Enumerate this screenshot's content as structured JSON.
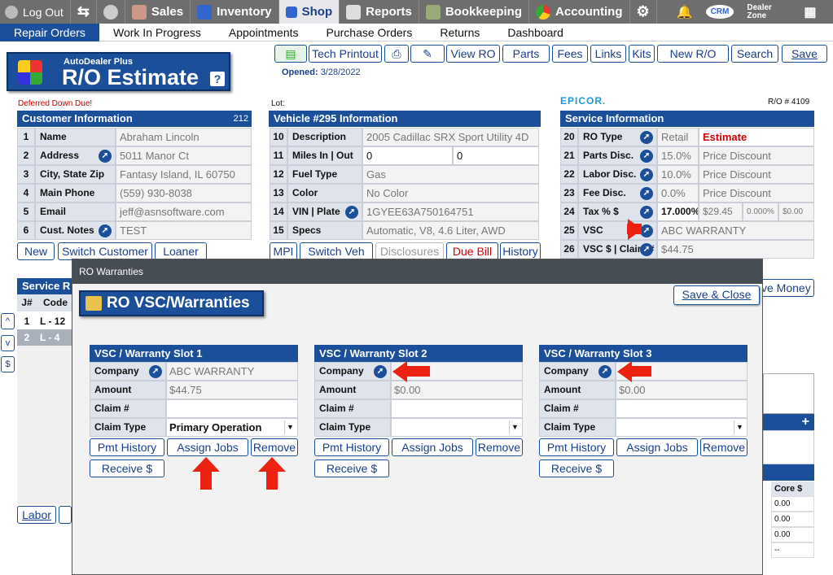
{
  "topnav": {
    "logout": "Log Out",
    "sales": "Sales",
    "inventory": "Inventory",
    "shop": "Shop",
    "reports": "Reports",
    "bookkeeping": "Bookkeeping",
    "accounting": "Accounting",
    "crm": "CRM",
    "dealer_zone": "Dealer Zone"
  },
  "subnav": [
    "Repair Orders",
    "Work In Progress",
    "Appointments",
    "Purchase Orders",
    "Returns",
    "Dashboard"
  ],
  "brand": {
    "small": "AutoDealer Plus",
    "title": "R/O Estimate",
    "help": "?"
  },
  "toolbar": {
    "tech_printout": "Tech Printout",
    "view_ro": "View RO",
    "parts": "Parts",
    "fees": "Fees",
    "links": "Links",
    "kits": "Kits",
    "new_ro": "New R/O",
    "search": "Search",
    "save": "Save"
  },
  "opened_label": "Opened:",
  "opened_date": "3/28/2022",
  "deferred": "Deferred Down Due!",
  "lot_label": "Lot:",
  "epicor": "EPICOR.",
  "ro_number": "R/O # 4109",
  "customer": {
    "title": "Customer Information",
    "code": "212",
    "rows": [
      {
        "n": "1",
        "label": "Name",
        "value": "Abraham Lincoln"
      },
      {
        "n": "2",
        "label": "Address",
        "value": "5011 Manor Ct"
      },
      {
        "n": "3",
        "label": "City, State Zip",
        "value": "Fantasy Island, IL 60750"
      },
      {
        "n": "4",
        "label": "Main Phone",
        "value": "(559) 930-8038"
      },
      {
        "n": "5",
        "label": "Email",
        "value": "jeff@asnsoftware.com"
      },
      {
        "n": "6",
        "label": "Cust. Notes",
        "value": "TEST"
      }
    ],
    "buttons": {
      "new": "New",
      "switch": "Switch Customer",
      "loaner": "Loaner"
    }
  },
  "vehicle": {
    "title": "Vehicle #295 Information",
    "rows": [
      {
        "n": "10",
        "label": "Description",
        "value": "2005 Cadillac SRX Sport Utility 4D"
      },
      {
        "n": "11",
        "label": "Miles  In | Out",
        "value": "0",
        "value2": "0"
      },
      {
        "n": "12",
        "label": "Fuel Type",
        "value": "Gas"
      },
      {
        "n": "13",
        "label": "Color",
        "value": "No Color"
      },
      {
        "n": "14",
        "label": "VIN | Plate",
        "value": "1GYEE63A750164751"
      },
      {
        "n": "15",
        "label": "Specs",
        "value": "Automatic, V8, 4.6 Liter, AWD"
      }
    ],
    "buttons": {
      "mpi": "MPI",
      "switch": "Switch Veh",
      "disclosures": "Disclosures",
      "due_bill": "Due Bill",
      "history": "History"
    }
  },
  "service": {
    "title": "Service Information",
    "rows": [
      {
        "n": "20",
        "label": "RO Type",
        "value": "Retail",
        "value2": "Estimate"
      },
      {
        "n": "21",
        "label": "Parts Disc.",
        "value": "15.0%",
        "value2": "Price Discount"
      },
      {
        "n": "22",
        "label": "Labor Disc.",
        "value": "10.0%",
        "value2": "Price Discount"
      },
      {
        "n": "23",
        "label": "Fee Disc.",
        "value": "0.0%",
        "value2": "Price Discount"
      },
      {
        "n": "24",
        "label": "Tax % $",
        "value": "17.000%",
        "value2": "$29.45",
        "value3": "0.000%",
        "value4": "$0.00"
      },
      {
        "n": "25",
        "label": "VSC",
        "value": "ABC WARRANTY"
      },
      {
        "n": "26",
        "label": "VSC $ | Claim #",
        "value": "$44.75"
      }
    ],
    "save_money": "ve Money"
  },
  "service_req": {
    "title": "Service R",
    "cols": [
      "J#",
      "Code"
    ],
    "rows": [
      [
        "1",
        "L - 12"
      ],
      [
        "2",
        "L - 4"
      ]
    ],
    "labor": "Labor",
    "side_btns": [
      "^",
      "v",
      "$"
    ]
  },
  "right_table": {
    "header": "Core $",
    "values": [
      "0.00",
      "0.00",
      "0.00",
      "--"
    ]
  },
  "modal": {
    "window_title": "RO Warranties",
    "heading": "RO VSC/Warranties",
    "save_close": "Save & Close",
    "slots": [
      {
        "title": "VSC / Warranty Slot 1",
        "company": "ABC WARRANTY",
        "amount": "$44.75",
        "claim": "",
        "claim_type": "Primary Operation"
      },
      {
        "title": "VSC / Warranty Slot 2",
        "company": "",
        "amount": "$0.00",
        "claim": "",
        "claim_type": ""
      },
      {
        "title": "VSC / Warranty Slot 3",
        "company": "",
        "amount": "$0.00",
        "claim": "",
        "claim_type": ""
      }
    ],
    "labels": {
      "company": "Company",
      "amount": "Amount",
      "claim": "Claim #",
      "claim_type": "Claim Type"
    },
    "buttons": {
      "pmt_history": "Pmt History",
      "assign_jobs": "Assign Jobs",
      "remove": "Remove",
      "receive": "Receive $"
    }
  }
}
